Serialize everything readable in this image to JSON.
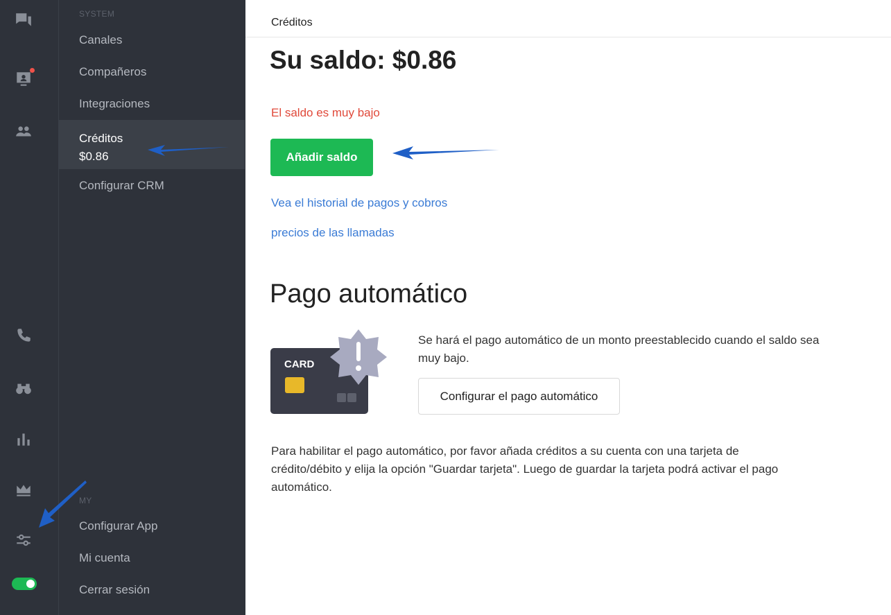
{
  "rail": {
    "icons": [
      "chat-icon",
      "contacts-icon",
      "team-icon",
      "phone-icon",
      "binoculars-icon",
      "stats-icon",
      "crown-icon",
      "settings-sliders-icon"
    ],
    "notification_color": "#f0524a",
    "toggle_on": true
  },
  "menu": {
    "system_label": "SYSTEM",
    "system_items": [
      {
        "label": "Canales"
      },
      {
        "label": "Compañeros"
      },
      {
        "label": "Integraciones"
      },
      {
        "label": "Créditos",
        "sub": "$0.86",
        "active": true
      },
      {
        "label": "Configurar CRM"
      }
    ],
    "my_label": "MY",
    "my_items": [
      {
        "label": "Configurar App"
      },
      {
        "label": "Mi cuenta"
      },
      {
        "label": "Cerrar sesión"
      }
    ]
  },
  "main": {
    "breadcrumb": "Créditos",
    "balance_title": "Su saldo: $0.86",
    "low_balance": "El saldo es muy bajo",
    "add_button": "Añadir saldo",
    "history_link": "Vea el historial de pagos y cobros",
    "prices_link": "precios de las llamadas",
    "auto_title": "Pago automático",
    "card_label": "CARD",
    "auto_desc": "Se hará el pago automático de un monto preestablecido cuando el saldo sea muy bajo.",
    "configure_button": "Configurar el pago automático",
    "note": "Para habilitar el pago automático, por favor añada créditos a su cuenta con una tarjeta de crédito/débito y elija la opción \"Guardar tarjeta\". Luego de guardar la tarjeta podrá activar el pago automático."
  },
  "colors": {
    "accent": "#1db954",
    "danger": "#e0493a",
    "link": "#3a7bd5",
    "sidebar": "#2e323a"
  }
}
